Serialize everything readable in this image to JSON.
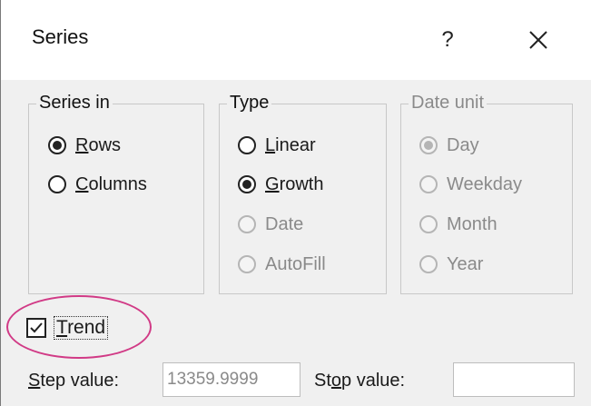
{
  "dialog": {
    "title": "Series",
    "help_glyph": "?",
    "close_icon": "close-icon"
  },
  "series_in": {
    "legend": "Series in",
    "options": [
      {
        "accel": "R",
        "rest": "ows",
        "checked": true
      },
      {
        "accel": "C",
        "rest": "olumns",
        "checked": false
      }
    ]
  },
  "type": {
    "legend": "Type",
    "options": [
      {
        "accel": "L",
        "rest": "inear",
        "checked": false,
        "enabled": true
      },
      {
        "accel": "G",
        "rest": "rowth",
        "checked": true,
        "enabled": true
      },
      {
        "label": "Date",
        "checked": false,
        "enabled": false
      },
      {
        "label": "AutoFill",
        "checked": false,
        "enabled": false
      }
    ]
  },
  "date_unit": {
    "legend": "Date unit",
    "enabled": false,
    "options": [
      {
        "label": "Day",
        "checked": true
      },
      {
        "label": "Weekday",
        "checked": false
      },
      {
        "label": "Month",
        "checked": false
      },
      {
        "label": "Year",
        "checked": false
      }
    ]
  },
  "trend": {
    "accel": "T",
    "rest": "rend",
    "checked": true
  },
  "step": {
    "label_pre": "S",
    "label_rest": "tep value:",
    "value": "13359.9999"
  },
  "stop": {
    "label_a": "St",
    "label_accel": "o",
    "label_rest": "p value:",
    "value": ""
  },
  "colors": {
    "highlight": "#d13a86",
    "dialog_bg": "#f0f0f0",
    "disabled_text": "#8a8a8a"
  }
}
